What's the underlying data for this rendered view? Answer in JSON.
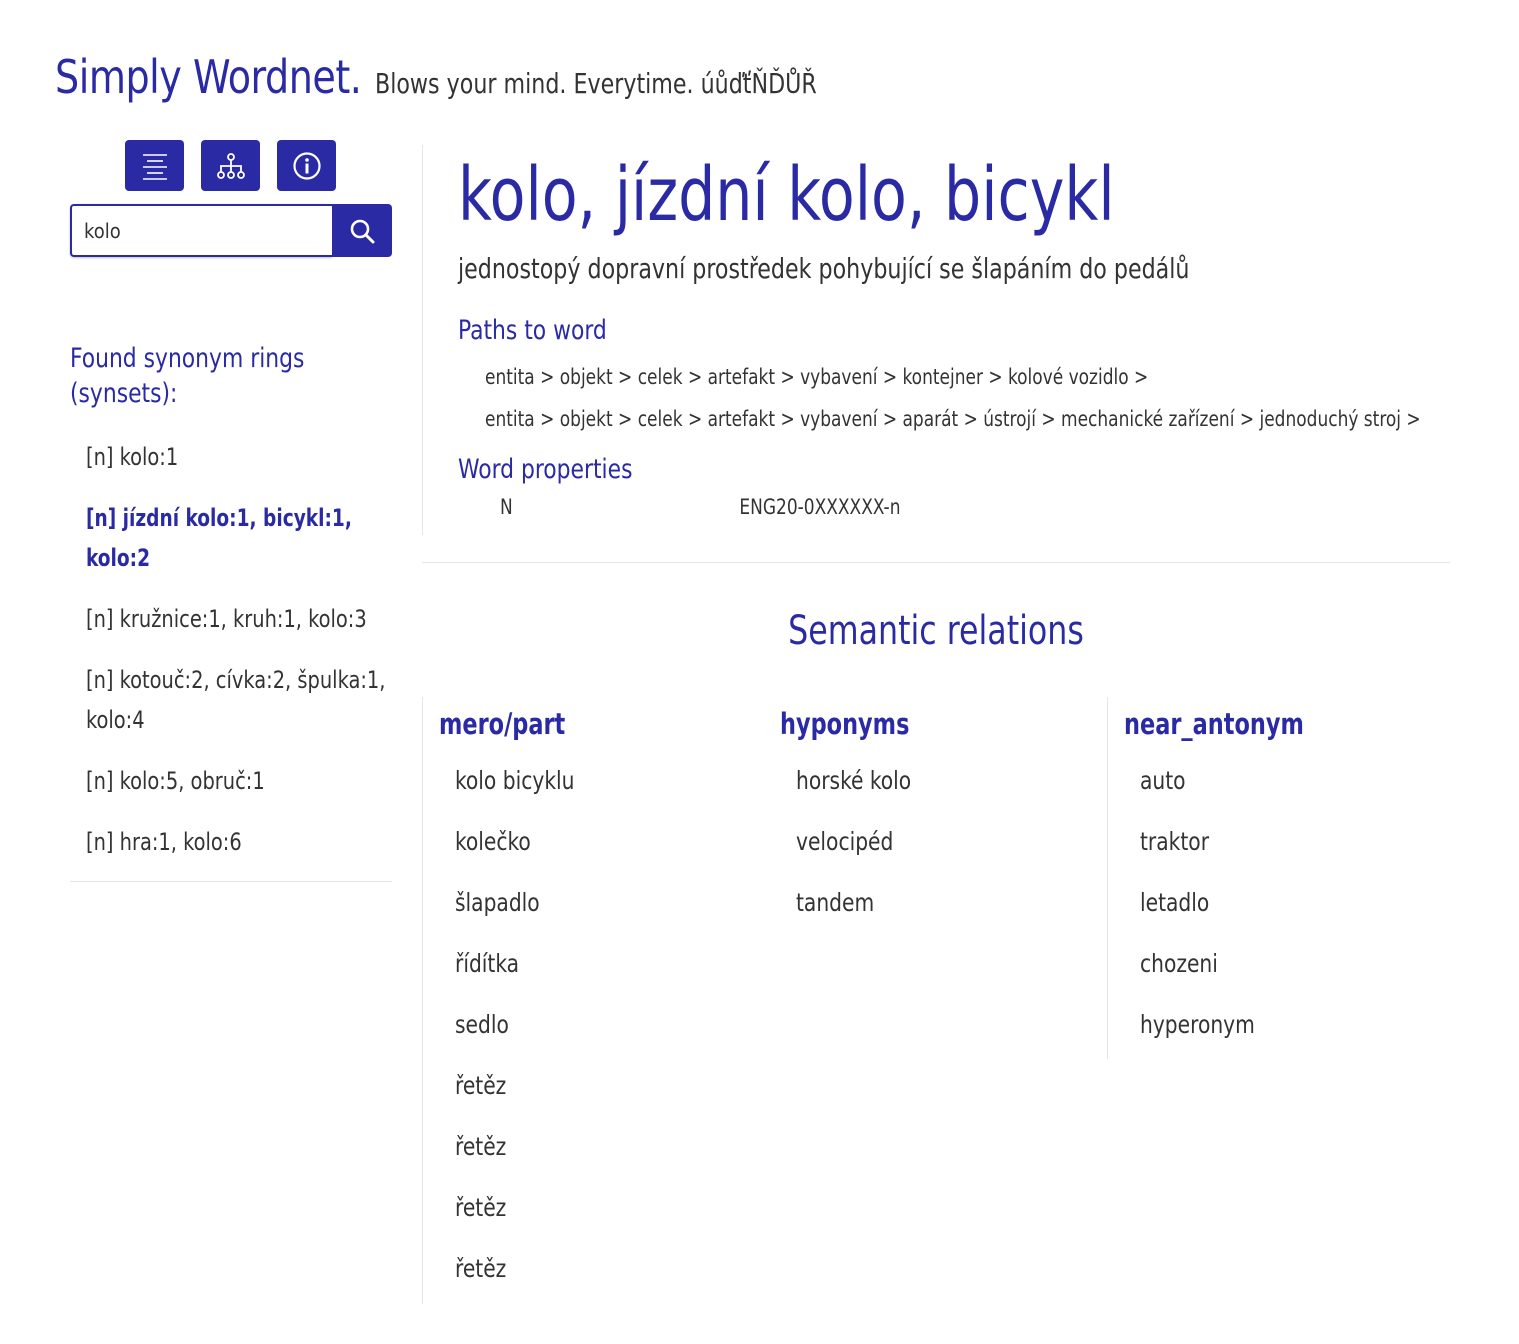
{
  "header": {
    "title": "Simply Wordnet.",
    "tagline": "Blows your mind. Everytime. úůďťŇĎŮŘ"
  },
  "toolbar": {
    "icons": [
      "list-icon",
      "hierarchy-icon",
      "info-icon"
    ]
  },
  "search": {
    "value": "kolo",
    "placeholder": ""
  },
  "synsets": {
    "heading": "Found synonym rings (synsets):",
    "items": [
      {
        "label": "[n] kolo:1"
      },
      {
        "label": "[n] jízdní kolo:1, bicykl:1, kolo:2",
        "active": true
      },
      {
        "label": "[n] kružnice:1, kruh:1, kolo:3"
      },
      {
        "label": "[n] kotouč:2, cívka:2, špulka:1, kolo:4"
      },
      {
        "label": "[n] kolo:5, obruč:1"
      },
      {
        "label": "[n] hra:1, kolo:6"
      }
    ]
  },
  "word": {
    "title": "kolo, jízdní kolo, bicykl",
    "definition": "jednostopý dopravní prostředek pohybující se šlapáním do pedálů",
    "paths_heading": "Paths to word",
    "paths": [
      "entita > objekt > celek > artefakt > vybavení > kontejner > kolové vozidlo >",
      "entita > objekt > celek > artefakt > vybavení > aparát > ústrojí > mechanické zařízení > jednoduchý stroj >"
    ],
    "properties_heading": "Word properties",
    "properties": {
      "pos": "N",
      "id": "ENG20-0XXXXXX-n"
    }
  },
  "relations": {
    "title": "Semantic relations",
    "columns": [
      {
        "heading": "mero/part",
        "items": [
          "kolo bicyklu",
          "kolečko",
          "šlapadlo",
          "řídítka",
          "sedlo",
          "řetěz",
          "řetěz",
          "řetěz",
          "řetěz"
        ]
      },
      {
        "heading": "hyponyms",
        "items": [
          "horské kolo",
          "velocipéd",
          "tandem"
        ]
      },
      {
        "heading": "near_antonym",
        "items": [
          "auto",
          "traktor",
          "letadlo",
          "chozeni",
          "hyperonym"
        ]
      }
    ]
  },
  "colors": {
    "accent": "#2a2aa5",
    "text": "#333333",
    "divider": "#e5e5e5"
  }
}
